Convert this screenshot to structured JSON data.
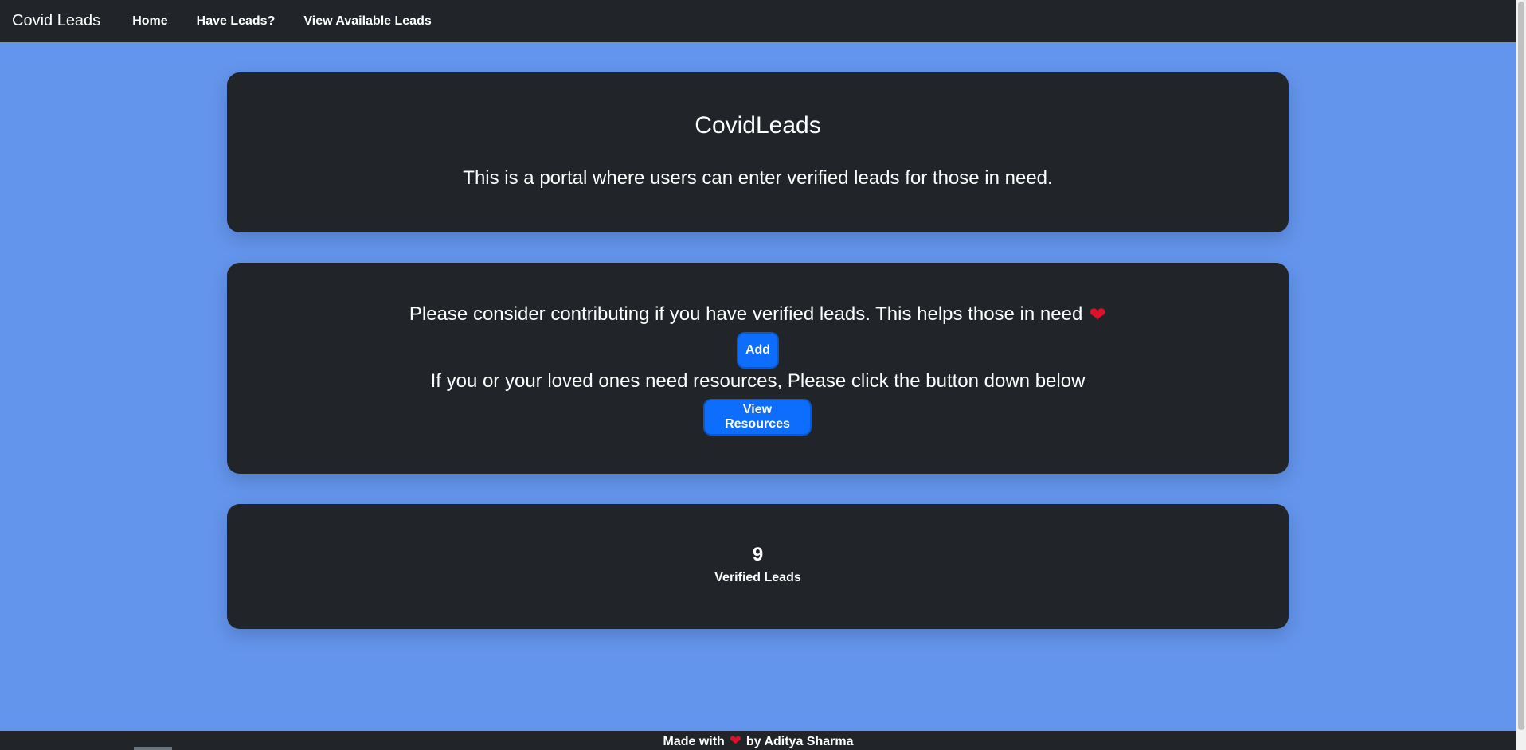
{
  "navbar": {
    "brand": "Covid Leads",
    "links": [
      "Home",
      "Have Leads?",
      "View Available Leads"
    ]
  },
  "hero": {
    "title": "CovidLeads",
    "subtitle": "This is a portal where users can enter verified leads for those in need."
  },
  "contribute": {
    "line1": "Please consider contributing if you have verified leads. This helps those in need",
    "add_label": "Add",
    "line2": "If you or your loved ones need resources, Please click the button down below",
    "view_label": "View Resources"
  },
  "stats": {
    "count": "9",
    "label": "Verified Leads"
  },
  "footer": {
    "prefix": "Made with",
    "suffix": "by",
    "author": "Aditya Sharma"
  },
  "colors": {
    "background": "#6495ed",
    "card": "#212529",
    "button": "#0d6efd",
    "heart": "#e0102a"
  },
  "icons": {
    "heart": "heart-icon"
  }
}
